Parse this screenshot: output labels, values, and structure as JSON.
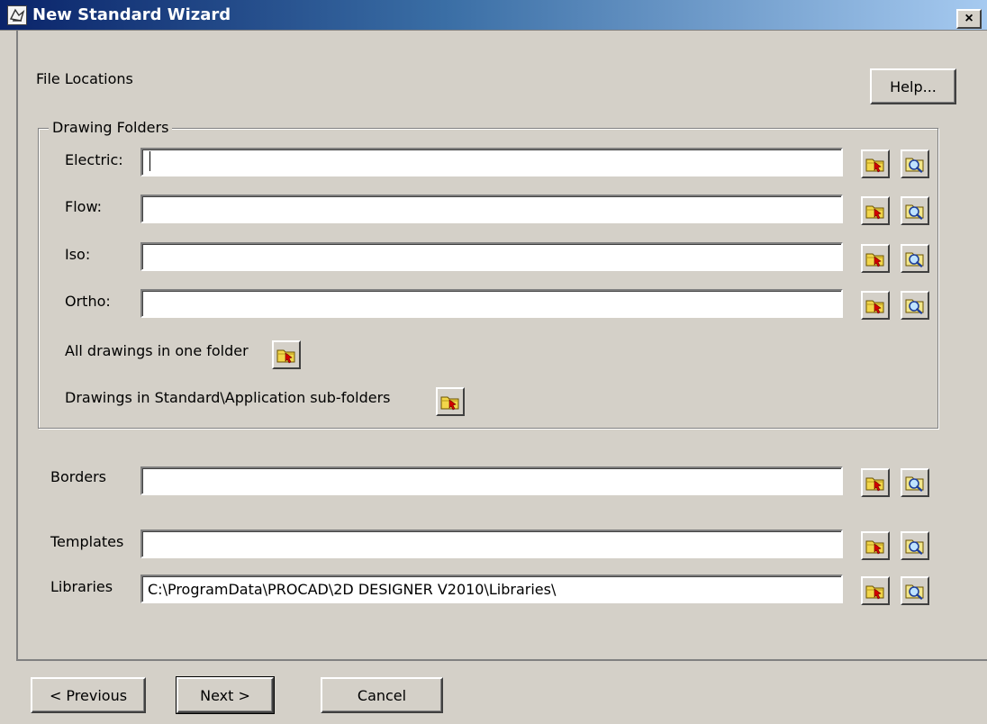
{
  "window": {
    "title": "New Standard Wizard",
    "close_label": "×"
  },
  "page": {
    "heading": "File Locations",
    "help_label": "Help..."
  },
  "drawing_folders": {
    "title": "Drawing Folders",
    "electric": {
      "label": "Electric:",
      "value": ""
    },
    "flow": {
      "label": "Flow:",
      "value": ""
    },
    "iso": {
      "label": "Iso:",
      "value": ""
    },
    "ortho": {
      "label": "Ortho:",
      "value": ""
    },
    "all_in_one_label": "All drawings in one folder",
    "sub_folders_label": "Drawings in Standard\\Application sub-folders"
  },
  "borders": {
    "label": "Borders",
    "value": ""
  },
  "templates": {
    "label": "Templates",
    "value": ""
  },
  "libraries": {
    "label": "Libraries",
    "value": "C:\\ProgramData\\PROCAD\\2D DESIGNER V2010\\Libraries\\"
  },
  "footer": {
    "previous_label": "< Previous",
    "next_label": "Next >",
    "cancel_label": "Cancel"
  },
  "icons": {
    "folder_select": "folder-arrow-icon",
    "browse": "folder-magnifier-icon"
  },
  "colors": {
    "title_gradient_start": "#0a246a",
    "title_gradient_end": "#a6caf0",
    "dialog_background": "#d4d0c8"
  }
}
